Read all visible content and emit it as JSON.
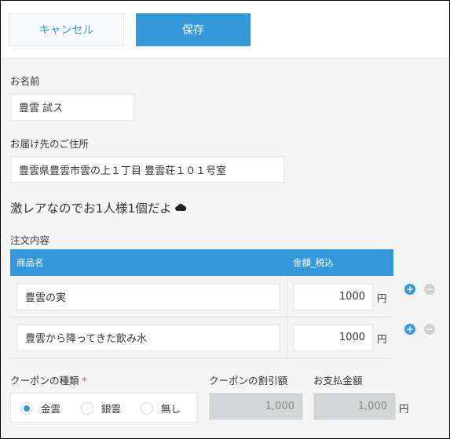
{
  "toolbar": {
    "cancel_label": "キャンセル",
    "save_label": "保存"
  },
  "name": {
    "label": "お名前",
    "value": "豊雲 試ス"
  },
  "address": {
    "label": "お届け先のご住所",
    "value": "豊雲県豊雲市雲の上１丁目 豊雲荘１０１号室"
  },
  "notice": {
    "text": "激レアなのでお1人様1個だよ",
    "icon": "cloud-icon"
  },
  "order": {
    "label": "注文内容",
    "columns": [
      "商品名",
      "金額_税込"
    ],
    "currency_unit": "円",
    "rows": [
      {
        "product": "豊雲の実",
        "amount": "1000"
      },
      {
        "product": "豊雲から降ってきた飲み水",
        "amount": "1000"
      }
    ]
  },
  "coupon": {
    "label": "クーポンの種類",
    "required_mark": "*",
    "options": [
      "金雲",
      "銀雲",
      "無し"
    ],
    "selected": "金雲"
  },
  "discount": {
    "label": "クーポンの割引額",
    "value": "1,000"
  },
  "payment": {
    "label": "お支払金額",
    "value": "1,000",
    "unit": "円"
  },
  "colors": {
    "accent": "#3498db",
    "required": "#e74c3c",
    "disabled": "#d4d7d7"
  }
}
